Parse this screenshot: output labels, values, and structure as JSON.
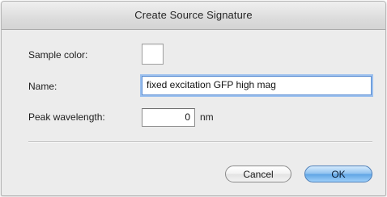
{
  "dialog": {
    "title": "Create Source Signature"
  },
  "form": {
    "sample_color_label": "Sample color:",
    "name_label": "Name:",
    "name_value": "fixed excitation GFP high mag",
    "peak_label": "Peak wavelength:",
    "peak_value": "0",
    "peak_unit": "nm"
  },
  "buttons": {
    "cancel": "Cancel",
    "ok": "OK"
  },
  "colors": {
    "default_button": "#5fa4e4",
    "focus_ring": "#9cc0ee"
  }
}
